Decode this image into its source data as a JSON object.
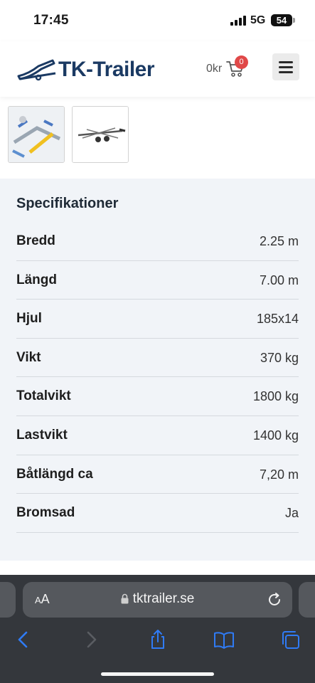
{
  "status_bar": {
    "time": "17:45",
    "network": "5G",
    "battery": "54"
  },
  "header": {
    "logo_text": "TK-Trailer",
    "cart_total": "0kr",
    "cart_count": "0",
    "menu_icon": "hamburger-menu-icon"
  },
  "gallery": {
    "thumbnails": [
      "trailer-photo-1",
      "trailer-photo-2"
    ]
  },
  "specs": {
    "title": "Specifikationer",
    "rows": [
      {
        "label": "Bredd",
        "value": "2.25 m"
      },
      {
        "label": "Längd",
        "value": "7.00 m"
      },
      {
        "label": "Hjul",
        "value": "185x14"
      },
      {
        "label": "Vikt",
        "value": "370 kg"
      },
      {
        "label": "Totalvikt",
        "value": "1800 kg"
      },
      {
        "label": "Lastvikt",
        "value": "1400 kg"
      },
      {
        "label": "Båtlängd ca",
        "value": "7,20 m"
      },
      {
        "label": "Bromsad",
        "value": "Ja"
      }
    ]
  },
  "browser": {
    "text_size_label": "AA",
    "url": "tktrailer.se",
    "colors": {
      "accent": "#2f7bf6",
      "toolbar_bg": "#34373c"
    }
  },
  "colors": {
    "brand": "#1b3a63",
    "badge": "#e04848",
    "spec_bg": "#f1f4f8"
  }
}
